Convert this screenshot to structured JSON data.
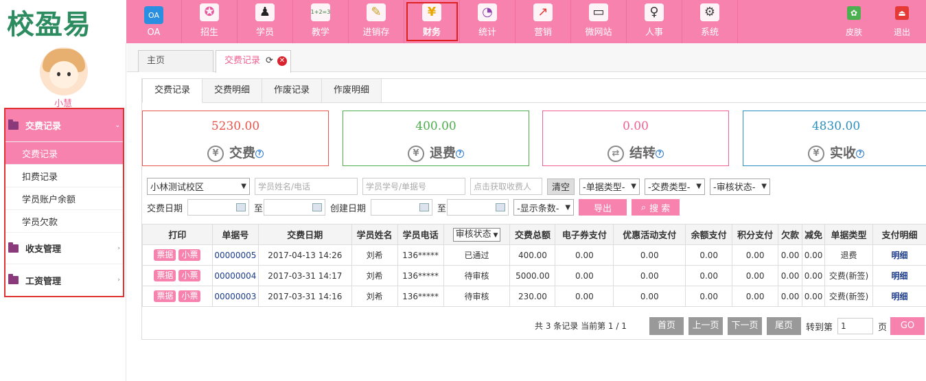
{
  "app": {
    "logo": "校盈易",
    "user": "小慧"
  },
  "nav": [
    {
      "label": "OA",
      "icon": "oa-icon",
      "glyph": "OA",
      "color": "#2a8fe0"
    },
    {
      "label": "招生",
      "icon": "recruit-icon",
      "glyph": "✪",
      "color": "#e85a9e"
    },
    {
      "label": "学员",
      "icon": "student-icon",
      "glyph": "♟",
      "color": "#222"
    },
    {
      "label": "教学",
      "icon": "blackboard-icon",
      "glyph": "1+2=3",
      "color": "#2e7d32"
    },
    {
      "label": "进销存",
      "icon": "inventory-icon",
      "glyph": "✎",
      "color": "#c8a020"
    },
    {
      "label": "财务",
      "icon": "finance-icon",
      "glyph": "¥",
      "color": "#e8a800"
    },
    {
      "label": "统计",
      "icon": "statistics-icon",
      "glyph": "◔",
      "color": "#8e44ad"
    },
    {
      "label": "营销",
      "icon": "marketing-icon",
      "glyph": "↗",
      "color": "#e53935"
    },
    {
      "label": "微网站",
      "icon": "monitor-icon",
      "glyph": "▭",
      "color": "#222"
    },
    {
      "label": "人事",
      "icon": "person-icon",
      "glyph": "♀",
      "color": "#333"
    },
    {
      "label": "系统",
      "icon": "gear-icon",
      "glyph": "⚙",
      "color": "#444"
    }
  ],
  "nav_active": "财务",
  "nav_right": [
    {
      "label": "皮肤",
      "icon": "skin-icon",
      "glyph": "✿",
      "color": "#4caf50"
    },
    {
      "label": "退出",
      "icon": "logout-icon",
      "glyph": "⏏",
      "color": "#e53935"
    }
  ],
  "sidebar": {
    "groups": [
      {
        "label": "交费记录",
        "arrow": "⌄",
        "items": [
          "交费记录",
          "扣费记录",
          "学员账户余额",
          "学员欠款"
        ]
      },
      {
        "label": "收支管理",
        "arrow": "›"
      },
      {
        "label": "工资管理",
        "arrow": "›"
      }
    ]
  },
  "page_tabs": [
    {
      "label": "主页"
    },
    {
      "label": "交费记录"
    }
  ],
  "sub_tabs": [
    "交费记录",
    "交费明细",
    "作废记录",
    "作废明细"
  ],
  "cards": [
    {
      "value": "5230.00",
      "label": "交费",
      "color": "#e8544a",
      "border": "#e8544a",
      "glyph": "¥"
    },
    {
      "value": "400.00",
      "label": "退费",
      "color": "#4cae4c",
      "border": "#4cae4c",
      "glyph": "¥"
    },
    {
      "value": "0.00",
      "label": "结转",
      "color": "#f06090",
      "border": "#f06090",
      "glyph": "⇄"
    },
    {
      "value": "4830.00",
      "label": "实收",
      "color": "#2a8fc0",
      "border": "#2a8fc0",
      "glyph": "¥"
    }
  ],
  "filters": {
    "campus": "小林测试校区",
    "name_ph": "学员姓名/电话",
    "id_ph": "学员学号/单据号",
    "receiver_ph": "点击获取收费人",
    "clear": "清空",
    "doc_type": "-单据类型-",
    "pay_type": "-交费类型-",
    "audit": "-审核状态-",
    "pay_date": "交费日期",
    "to1": "至",
    "create_date": "创建日期",
    "to2": "至",
    "count": "-显示条数-",
    "export": "导出",
    "search": "搜 索"
  },
  "table": {
    "headers": [
      "打印",
      "单据号",
      "交费日期",
      "学员姓名",
      "学员电话",
      "审核状态",
      "交费总额",
      "电子券支付",
      "优惠活动支付",
      "余额支付",
      "积分支付",
      "欠款",
      "减免",
      "单据类型",
      "支付明细"
    ],
    "print_btns": [
      "票据",
      "小票"
    ],
    "rows": [
      {
        "no": "00000005",
        "date": "2017-04-13 14:26",
        "name": "刘希",
        "phone": "136*****",
        "status": "已通过",
        "total": "400.00",
        "coupon": "0.00",
        "promo": "0.00",
        "balance": "0.00",
        "points": "0.00",
        "debt": "0.00",
        "reduce": "0.00",
        "type": "退费",
        "detail": "明细"
      },
      {
        "no": "00000004",
        "date": "2017-03-31 14:17",
        "name": "刘希",
        "phone": "136*****",
        "status": "待审核",
        "total": "5000.00",
        "coupon": "0.00",
        "promo": "0.00",
        "balance": "0.00",
        "points": "0.00",
        "debt": "0.00",
        "reduce": "0.00",
        "type": "交费(新签)",
        "detail": "明细"
      },
      {
        "no": "00000003",
        "date": "2017-03-31 14:16",
        "name": "刘希",
        "phone": "136*****",
        "status": "待审核",
        "total": "230.00",
        "coupon": "0.00",
        "promo": "0.00",
        "balance": "0.00",
        "points": "0.00",
        "debt": "0.00",
        "reduce": "0.00",
        "type": "交费(新签)",
        "detail": "明细"
      }
    ]
  },
  "pager": {
    "info": "共 3 条记录 当前第 1 / 1",
    "first": "首页",
    "prev": "上一页",
    "next": "下一页",
    "last": "尾页",
    "goto": "转到第",
    "page_val": "1",
    "page_unit": "页",
    "go": "GO"
  }
}
